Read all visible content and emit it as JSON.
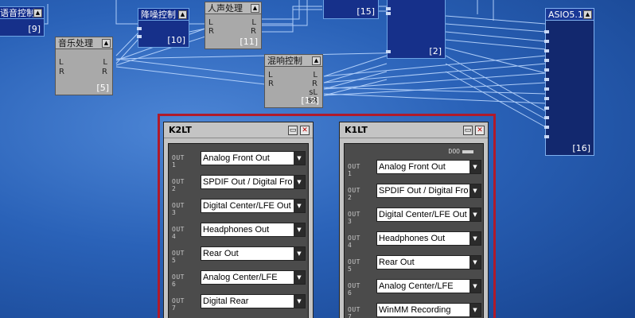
{
  "nodes": {
    "left_partial": {
      "title": "语音控制",
      "num": "[9]"
    },
    "music": {
      "title": "音乐处理",
      "num": "[5]",
      "pins_in": [
        "L",
        "R"
      ],
      "pins_out": [
        "L",
        "R"
      ]
    },
    "denoise": {
      "title": "降噪控制",
      "num": "[10]"
    },
    "vocal": {
      "title": "人声处理",
      "num": "[11]",
      "pins_in": [
        "L",
        "R"
      ],
      "pins_out": [
        "L",
        "R"
      ]
    },
    "reverb": {
      "title": "混响控制",
      "num": "[12]",
      "pins_in": [
        "L",
        "R"
      ],
      "pins_out": [
        "L",
        "R",
        "sL",
        "sR"
      ]
    },
    "top_mid": {
      "num": "[15]"
    },
    "mid_box": {
      "num": "[2]"
    },
    "asio": {
      "title": "ASIO5.1",
      "num": "[16]"
    }
  },
  "panels": {
    "k2lt": {
      "title": "K2LT",
      "minimize": "▭",
      "close": "✕",
      "rows": [
        {
          "label": "OUT 1",
          "value": "Analog Front Out"
        },
        {
          "label": "OUT 2",
          "value": "SPDIF Out / Digital Fro"
        },
        {
          "label": "OUT 3",
          "value": "Digital Center/LFE Out"
        },
        {
          "label": "OUT 4",
          "value": "Headphones Out"
        },
        {
          "label": "OUT 5",
          "value": "Rear Out"
        },
        {
          "label": "OUT 6",
          "value": "Analog Center/LFE"
        },
        {
          "label": "OUT 7",
          "value": "Digital Rear"
        }
      ]
    },
    "k1lt": {
      "title": "K1LT",
      "minimize": "▭",
      "close": "✕",
      "indicator": "DOO",
      "rows": [
        {
          "label": "OUT 1",
          "value": "Analog Front Out"
        },
        {
          "label": "OUT 2",
          "value": "SPDIF Out / Digital Fro"
        },
        {
          "label": "OUT 3",
          "value": "Digital Center/LFE Out"
        },
        {
          "label": "OUT 4",
          "value": "Headphones Out"
        },
        {
          "label": "OUT 5",
          "value": "Rear Out"
        },
        {
          "label": "OUT 6",
          "value": "Analog Center/LFE"
        },
        {
          "label": "OUT 7",
          "value": "WinMM Recording"
        }
      ]
    }
  },
  "icons": {
    "dropdown": "▼",
    "collapse": "▲"
  },
  "colors": {
    "frame": "#b01a2a",
    "wire": "#bcd8ff",
    "background": "#2a62b8"
  }
}
